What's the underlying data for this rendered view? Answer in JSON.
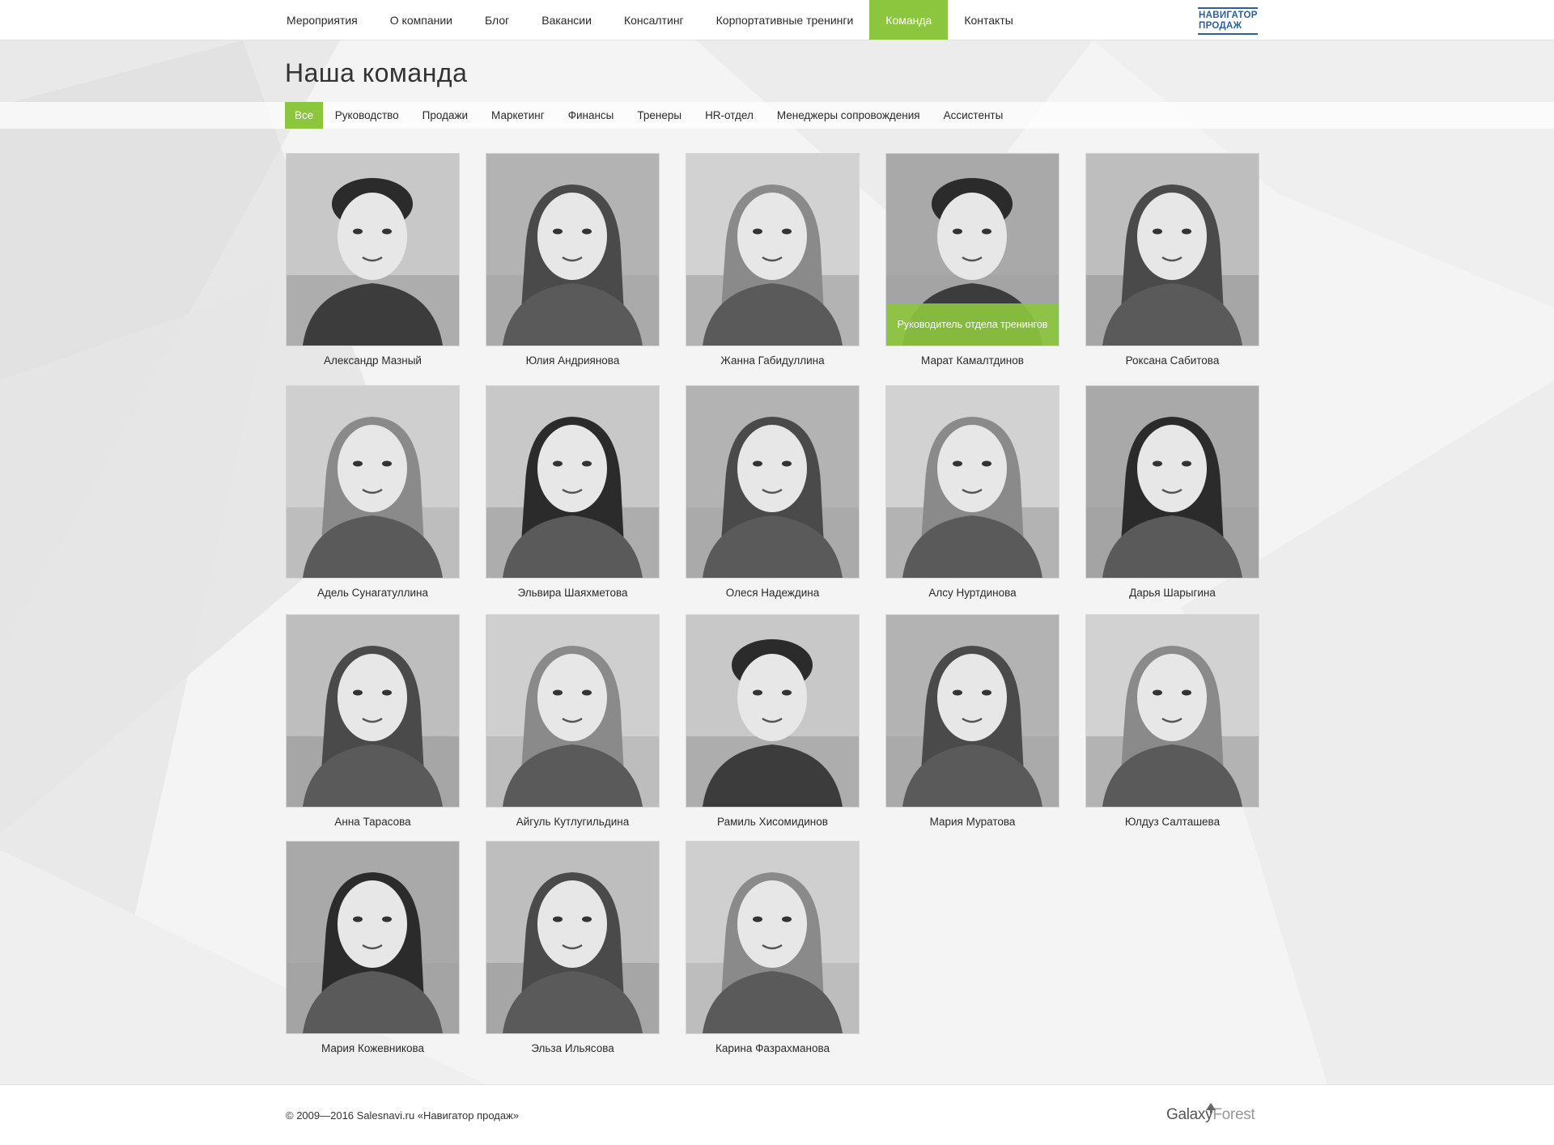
{
  "nav": {
    "items": [
      {
        "label": "Мероприятия",
        "active": false
      },
      {
        "label": "О компании",
        "active": false
      },
      {
        "label": "Блог",
        "active": false
      },
      {
        "label": "Вакансии",
        "active": false
      },
      {
        "label": "Консалтинг",
        "active": false
      },
      {
        "label": "Корпортативные тренинги",
        "active": false
      },
      {
        "label": "Команда",
        "active": true
      },
      {
        "label": "Контакты",
        "active": false
      }
    ],
    "logo_line1": "НАВИГАТОР",
    "logo_line2": "ПРОДАЖ"
  },
  "page": {
    "title": "Наша команда"
  },
  "filters": {
    "items": [
      {
        "label": "Все",
        "active": true
      },
      {
        "label": "Руководство",
        "active": false
      },
      {
        "label": "Продажи",
        "active": false
      },
      {
        "label": "Маркетинг",
        "active": false
      },
      {
        "label": "Финансы",
        "active": false
      },
      {
        "label": "Тренеры",
        "active": false
      },
      {
        "label": "HR-отдел",
        "active": false
      },
      {
        "label": "Менеджеры сопровождения",
        "active": false
      },
      {
        "label": "Ассистенты",
        "active": false
      }
    ]
  },
  "team": [
    {
      "name": "Александр Мазный",
      "gender": "m"
    },
    {
      "name": "Юлия Андриянова",
      "gender": "f"
    },
    {
      "name": "Жанна Габидуллина",
      "gender": "f"
    },
    {
      "name": "Марат Камалтдинов",
      "gender": "m",
      "role": "Руководитель отдела тренингов"
    },
    {
      "name": "Роксана Сабитова",
      "gender": "f"
    },
    {
      "name": "Адель Сунагатуллина",
      "gender": "f"
    },
    {
      "name": "Эльвира Шаяхметова",
      "gender": "f"
    },
    {
      "name": "Олеся Надеждина",
      "gender": "f"
    },
    {
      "name": "Алсу Нуртдинова",
      "gender": "f"
    },
    {
      "name": "Дарья Шарыгина",
      "gender": "f"
    },
    {
      "name": "Анна Тарасова",
      "gender": "f"
    },
    {
      "name": "Айгуль  Кутлугильдина",
      "gender": "f"
    },
    {
      "name": "Рамиль Хисомидинов",
      "gender": "m"
    },
    {
      "name": "Мария Муратова",
      "gender": "f"
    },
    {
      "name": "Юлдуз Салташева",
      "gender": "f"
    },
    {
      "name": "Мария Кожевникова",
      "gender": "f"
    },
    {
      "name": "Эльза Ильясова",
      "gender": "f"
    },
    {
      "name": "Карина Фазрахманова",
      "gender": "f"
    }
  ],
  "footer": {
    "copyright": "© 2009—2016 Salesnavi.ru «Навигатор продаж»",
    "brand_a": "Galaxy",
    "brand_b": "Forest"
  },
  "colors": {
    "accent": "#8cc63f",
    "logo": "#2d5f9a"
  }
}
